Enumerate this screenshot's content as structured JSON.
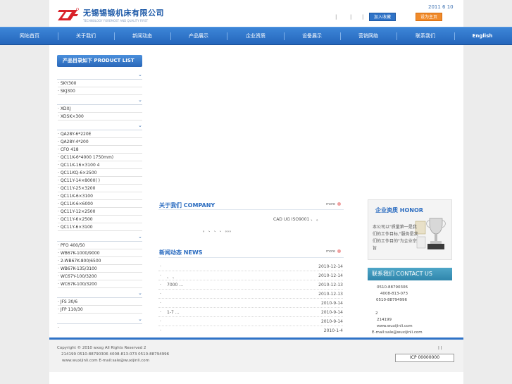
{
  "header": {
    "company_cn": "无锡锡锻机床有限公司",
    "company_en": "TECHNOLOGY FOREMOST AND QUALITY FIRST",
    "date": "2011  6  10",
    "add_fav": "加入收藏",
    "set_home": "设为主页",
    "separators": [
      "|",
      "|",
      "|"
    ]
  },
  "nav": {
    "items": [
      "网站首页",
      "关于我们",
      "新闻动态",
      "产品展示",
      "企业资质",
      "设备展示",
      "营销网络",
      "联系我们"
    ],
    "english": "English"
  },
  "sidebar": {
    "heading": "产品目录如下 PRODUCT LIST",
    "groups": [
      {
        "items": [
          "· SKY300",
          "· SKJ300"
        ]
      },
      {
        "items": [
          "· XDXJ",
          "· XDSK×300"
        ]
      },
      {
        "items": [
          "· QA28Y-6*220E",
          "· QA28Y-4*200",
          "· CFO 418",
          "· QC11K-6*4000      1750mm)",
          "· QC11K-16×3100 4",
          "· QC11KQ-6×2500",
          "· QC11Y-14×8000(  )",
          "· QC11Y-25×3200",
          "· QC11K-6×3100",
          "· QC11K-6×6000",
          "· QC11Y-12×2500",
          "· QC11Y-6×2500",
          "· QC11Y-6×3100"
        ]
      },
      {
        "items": [
          "· PFO 400/50",
          "· WB67K-1000/9000",
          "· 2-WB67K-800/6500",
          "· WB67K-135/3100",
          "· WC67Y-100/3200",
          "· WC67K-100/3200"
        ]
      },
      {
        "items": [
          "· JFS 30/6",
          "· JFP 110/30"
        ]
      },
      {
        "items": [
          "·"
        ]
      }
    ],
    "toggle": "⌄"
  },
  "company": {
    "title": "关于我们 COMPANY",
    "more": "more",
    "line1": "CAD UG      ISO9001       、 。",
    "line2": "。      、     、    、          。。。"
  },
  "news": {
    "title": "新闻动态 NEWS",
    "more": "more",
    "rows": [
      {
        "title": "",
        "date": "2010-12-14"
      },
      {
        "title": "      、 、",
        "date": "2010-12-14"
      },
      {
        "title": "      7000      …",
        "date": "2010-12-13"
      },
      {
        "title": "",
        "date": "2010-12-13"
      },
      {
        "title": "",
        "date": "2010-9-14"
      },
      {
        "title": "1-7              …",
        "date": "2010-9-14"
      },
      {
        "title": "",
        "date": "2010-9-14"
      },
      {
        "title": "",
        "date": "2010-1-4"
      }
    ],
    "bullet": "·"
  },
  "honor": {
    "title": "企业资质 HONOR",
    "text": "本公司以\"质量第一是我们的工作目标,\"服务是我们的工作目的\"为企业宗旨"
  },
  "contact": {
    "title": "联系我们 CONTACT US",
    "lines": [
      "0510-88790306",
      "4008-813-073",
      "0510-88794996",
      "2",
      "214199",
      "www.wuxijinli.com",
      "E-mail:sale@wuxijinli.com"
    ]
  },
  "footer": {
    "line1": "Copyright © 2010 wxxg      All Rights Reserved           2",
    "line2": "214199      0510-88790306      4008-813-073   0510-88794996",
    "line3": "www.wuxijinli.com  E-mail:sale@wuxijinli.com",
    "pipes": "|    |",
    "icp": "ICP  00000000"
  },
  "colors": {
    "nav": "#2566bb",
    "accent": "#2b6cc0",
    "orange": "#f08a2a"
  }
}
